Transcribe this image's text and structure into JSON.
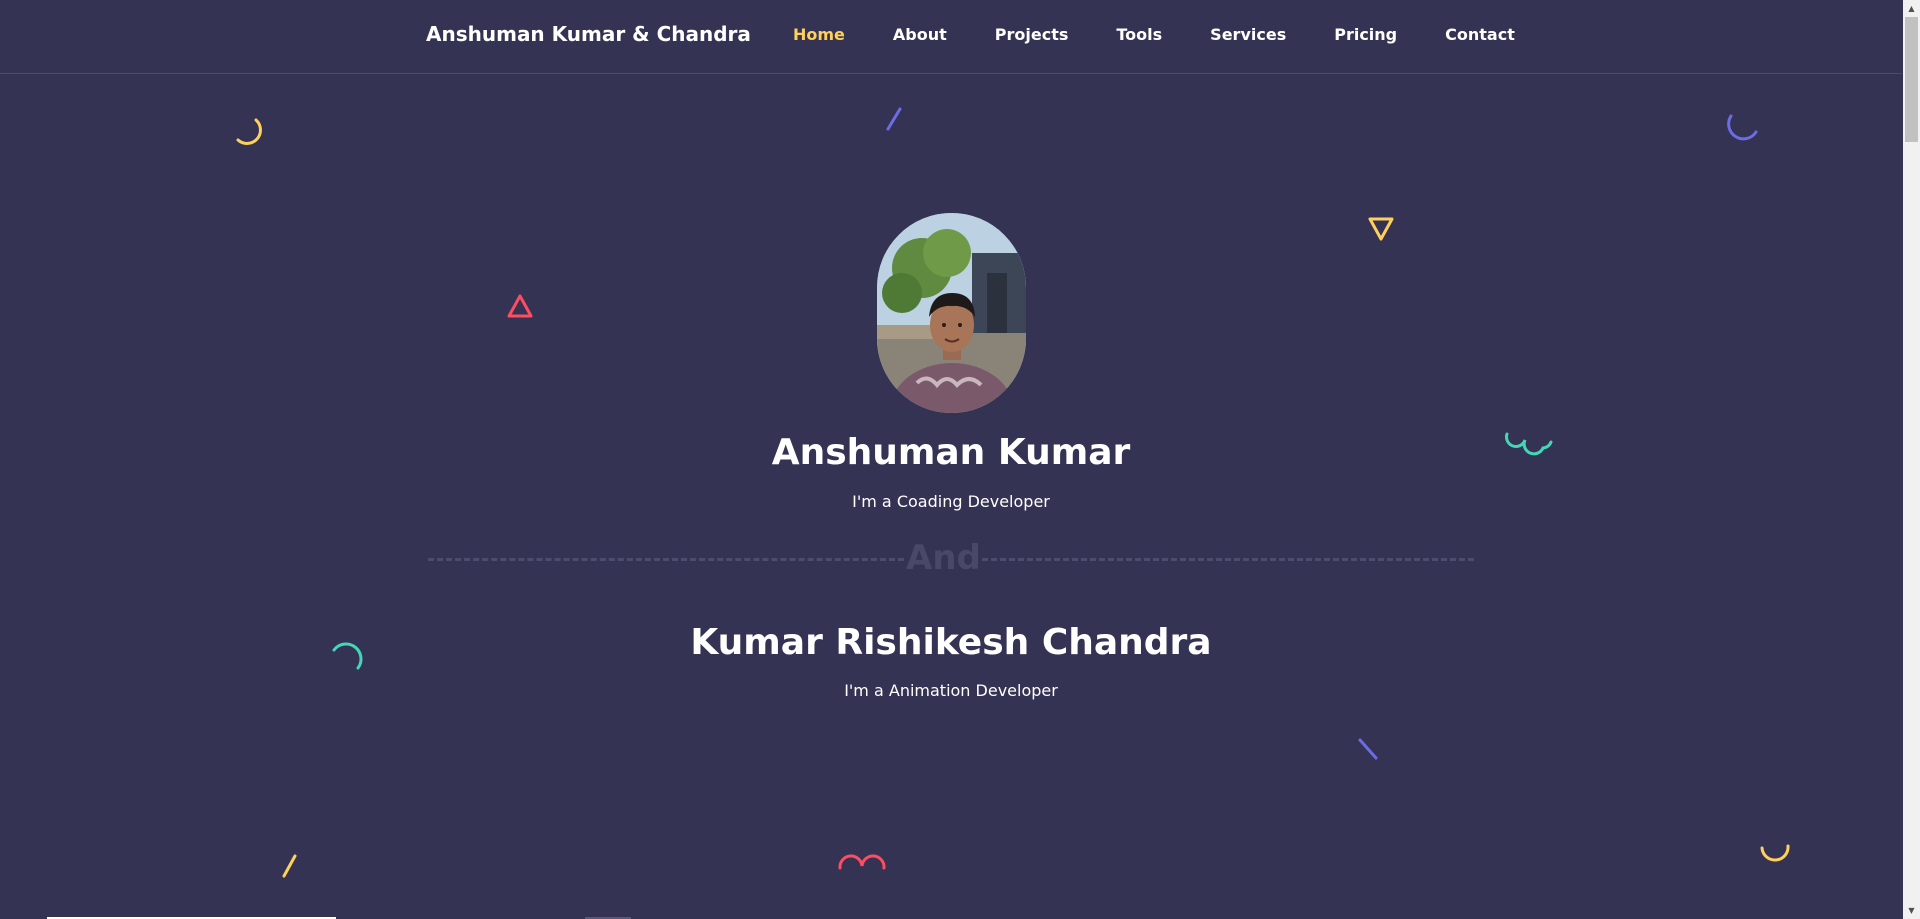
{
  "header": {
    "brand": "Anshuman Kumar & Chandra",
    "nav": [
      {
        "label": "Home",
        "active": true
      },
      {
        "label": "About",
        "active": false
      },
      {
        "label": "Projects",
        "active": false
      },
      {
        "label": "Tools",
        "active": false
      },
      {
        "label": "Services",
        "active": false
      },
      {
        "label": "Pricing",
        "active": false
      },
      {
        "label": "Contact",
        "active": false
      }
    ]
  },
  "hero": {
    "person1": {
      "name": "Anshuman Kumar",
      "role": "I'm a Coading Developer"
    },
    "separator": "And",
    "person2": {
      "name": "Kumar Rishikesh Chandra",
      "role": "I'm a Animation Developer"
    }
  },
  "colors": {
    "background": "#353353",
    "accent_yellow": "#FFD15C",
    "accent_red": "#FF4C60",
    "accent_purple": "#6C6CE5",
    "accent_teal": "#44D7B6"
  },
  "icons": {
    "avatar": "profile-photo",
    "decor": [
      "arc",
      "line",
      "triangle",
      "squiggle"
    ]
  }
}
